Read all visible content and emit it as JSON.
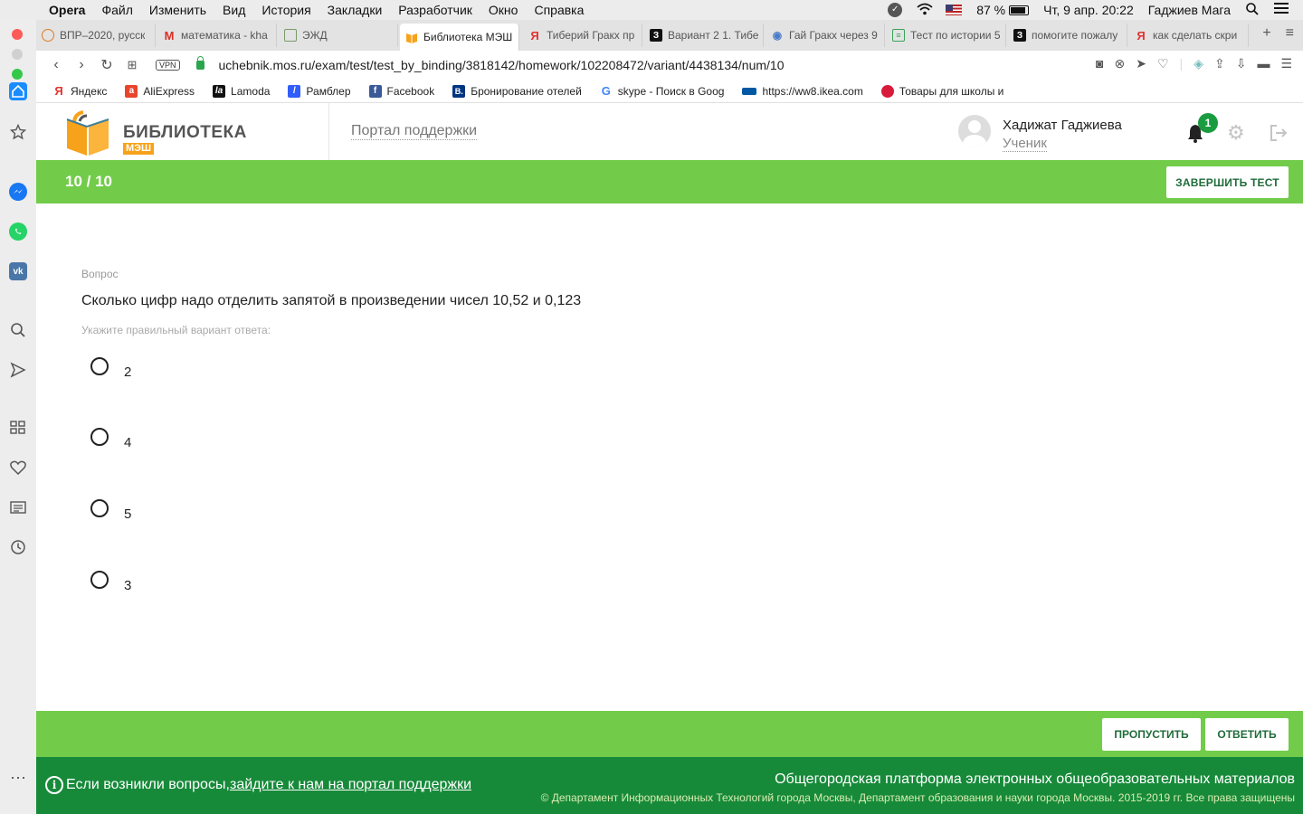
{
  "menubar": {
    "app": "Opera",
    "items": [
      "Файл",
      "Изменить",
      "Вид",
      "История",
      "Закладки",
      "Разработчик",
      "Окно",
      "Справка"
    ],
    "battery": "87 %",
    "datetime": "Чт, 9 апр.  20:22",
    "user": "Гаджиев Мага"
  },
  "tabs": [
    {
      "label": "ВПР–2020, русск",
      "icon": "globe-icon",
      "color": "#e07b21"
    },
    {
      "label": "математика - kha",
      "icon": "gmail-icon",
      "color": "#d93025"
    },
    {
      "label": "ЭЖД",
      "icon": "doc-icon",
      "color": "#7a9a6a"
    },
    {
      "label": "Библиотека МЭШ",
      "icon": "book-icon",
      "color": "#f7a21b"
    },
    {
      "label": "Тиберий Гракх пр",
      "icon": "yandex-icon",
      "color": "#e3342f"
    },
    {
      "label": "Вариант 2 1. Тибе",
      "icon": "znanija-icon",
      "color": "#111111"
    },
    {
      "label": "Гай Гракх через 9",
      "icon": "owl-icon",
      "color": "#4a7cc9"
    },
    {
      "label": "Тест по истории 5",
      "icon": "sheet-icon",
      "color": "#3aa35a"
    },
    {
      "label": "помогите пожалу",
      "icon": "znanija-icon",
      "color": "#111111"
    },
    {
      "label": "как сделать скри",
      "icon": "yandex-icon",
      "color": "#e3342f"
    }
  ],
  "address": {
    "vpn": "VPN",
    "url": "uchebnik.mos.ru/exam/test/test_by_binding/3818142/homework/102208472/variant/4438134/num/10"
  },
  "bookmarks": [
    {
      "label": "Яндекс",
      "icon": "yandex-icon",
      "color": "#e3342f",
      "glyph": "Я"
    },
    {
      "label": "AliExpress",
      "icon": "aliexpress-icon",
      "color": "#e8452c",
      "glyph": "a"
    },
    {
      "label": "Lamoda",
      "icon": "lamoda-icon",
      "color": "#111111",
      "glyph": "la"
    },
    {
      "label": "Рамблер",
      "icon": "rambler-icon",
      "color": "#315efb",
      "glyph": "/"
    },
    {
      "label": "Facebook",
      "icon": "facebook-icon",
      "color": "#3b5998",
      "glyph": "f"
    },
    {
      "label": "Бронирование отелей",
      "icon": "booking-icon",
      "color": "#003580",
      "glyph": "B."
    },
    {
      "label": "skype - Поиск в Goog",
      "icon": "google-icon",
      "color": "#4285f4",
      "glyph": "G"
    },
    {
      "label": "https://ww8.ikea.com",
      "icon": "ikea-icon",
      "color": "#0058a3",
      "glyph": "▬"
    },
    {
      "label": "Товары для школы и",
      "icon": "shop-icon",
      "color": "#d81b3b",
      "glyph": "●"
    }
  ],
  "header": {
    "logo_title": "БИБЛИОТЕКА",
    "logo_sub": "МЭШ",
    "support": "Портал поддержки",
    "user_name": "Хадижат Гаджиева",
    "user_role": "Ученик",
    "notifications": "1"
  },
  "test": {
    "progress": "10 / 10",
    "finish": "ЗАВЕРШИТЬ ТЕСТ",
    "question_label": "Вопрос",
    "question": "Сколько цифр надо отделить запятой в произведении чисел 10,52 и 0,123",
    "hint": "Укажите правильный вариант ответа:",
    "options": [
      "2",
      "4",
      "5",
      "3"
    ],
    "skip": "ПРОПУСТИТЬ",
    "answer": "ОТВЕТИТЬ"
  },
  "footer": {
    "question": "Если возникли вопросы,",
    "link": "зайдите к нам на портал поддержки",
    "platform": "Общегородская платформа электронных общеобразовательных материалов",
    "copyright": "© Департамент Информационных Технологий города Москвы, Департамент образования и науки города Москвы. 2015-2019 гг. Все права защищены"
  },
  "colors": {
    "accent_green": "#72cc4a",
    "footer_green": "#178a3a",
    "button_text": "#1f6b3a",
    "logo_orange": "#f7a21b"
  }
}
